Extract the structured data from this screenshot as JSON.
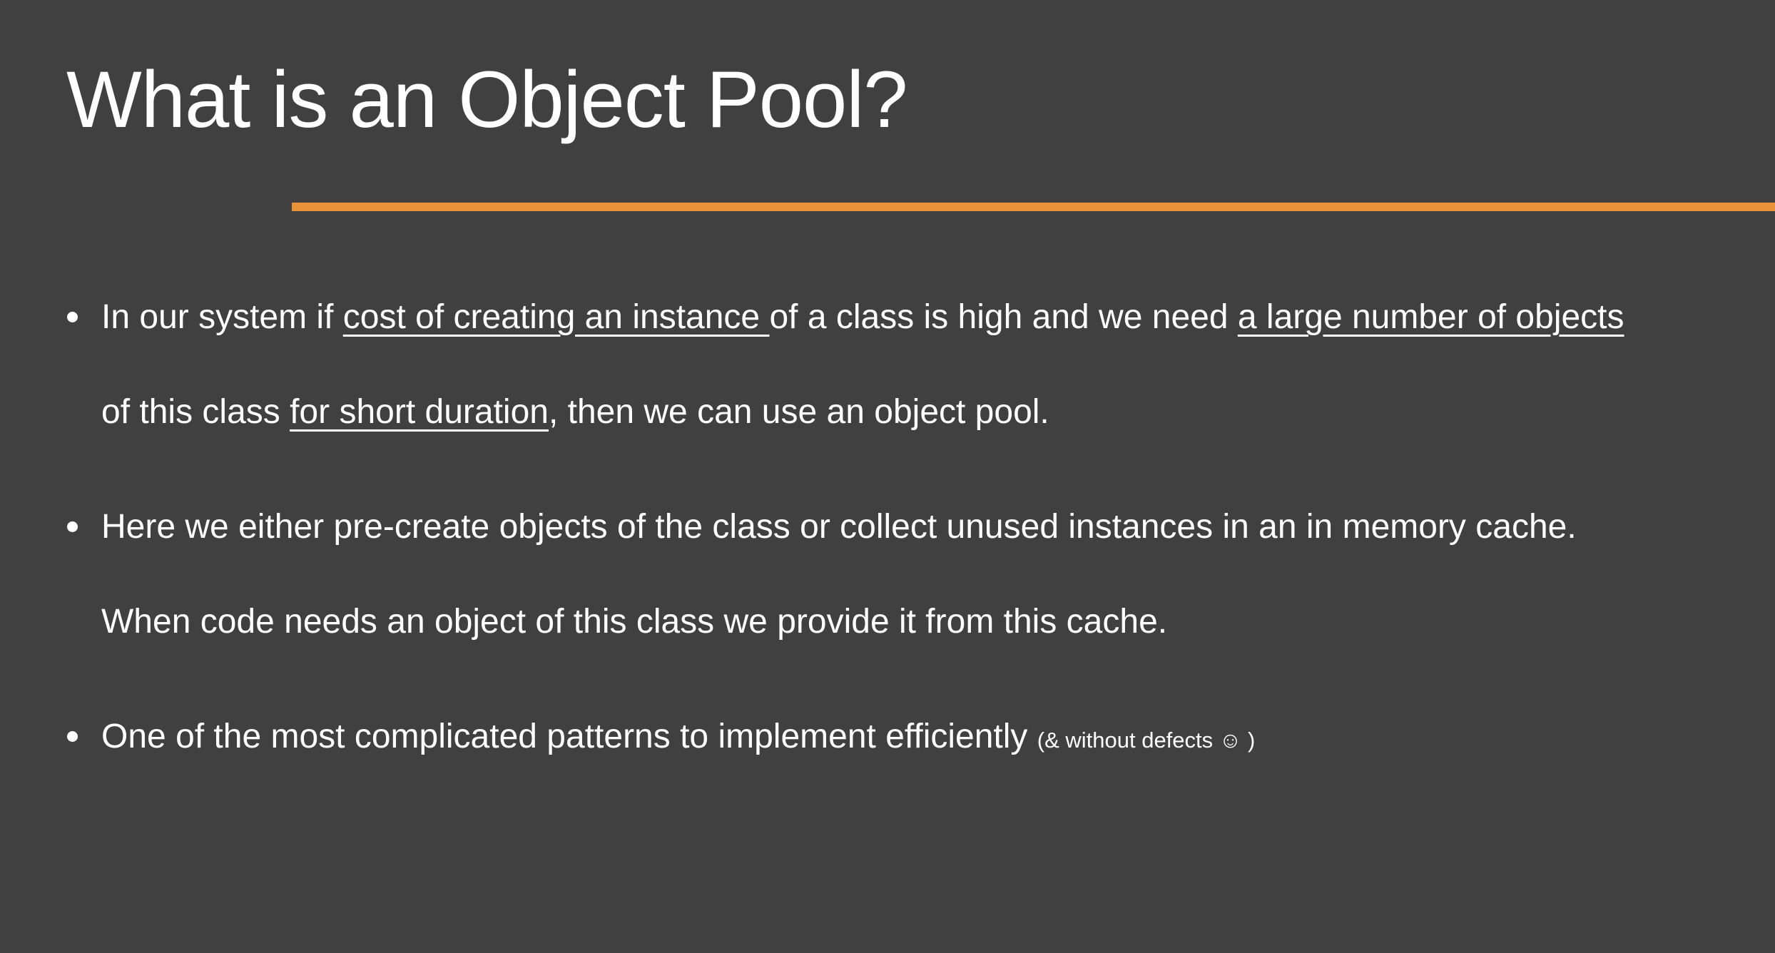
{
  "slide": {
    "title": "What is an Object Pool?",
    "accent_color": "#e8923a",
    "background_color": "#404040"
  },
  "bullets": [
    {
      "line1": {
        "a": "In our system if ",
        "b_underlined": "cost of creating an instance ",
        "c": "of a class is high and we need ",
        "d_underlined": "a large number of objects"
      },
      "line2": {
        "a": "of this class ",
        "b_underlined": "for short duration",
        "c": ", then we can use an object pool."
      }
    },
    {
      "line1": "Here we either pre-create objects of the class or collect unused instances in an in memory cache.",
      "line2": "When code needs an object of this class we provide it from this cache."
    },
    {
      "main": "One of the most complicated patterns to implement efficiently ",
      "aside": "(& without defects ☺ )"
    }
  ]
}
